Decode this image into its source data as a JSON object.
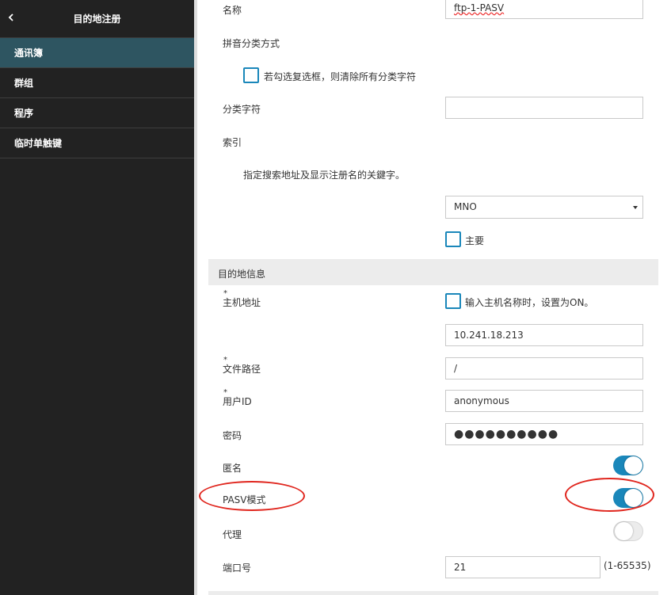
{
  "sidebar": {
    "title": "目的地注册",
    "items": [
      {
        "label": "通讯簿",
        "active": true
      },
      {
        "label": "群组"
      },
      {
        "label": "程序"
      },
      {
        "label": "临时单触键"
      }
    ]
  },
  "form": {
    "name": {
      "label": "名称",
      "value": "ftp-1-PASV"
    },
    "pinyin": {
      "label": "拼音分类方式",
      "checkbox_label": "若勾选复选框，则清除所有分类字符",
      "checked": false
    },
    "category_chars": {
      "label": "分类字符",
      "value": ""
    },
    "index": {
      "label": "索引",
      "description": "指定搜索地址及显示注册名的关鍵字。",
      "selected": "MNO",
      "main_label": "主要",
      "main_checked": false
    },
    "section_title": "目的地信息",
    "host": {
      "required_mark": "*",
      "label": "主机地址",
      "checkbox_label": "输入主机名称时，设置为ON。",
      "checked": false,
      "value": "10.241.18.213"
    },
    "file_path": {
      "required_mark": "*",
      "label": "文件路径",
      "value": "/"
    },
    "user_id": {
      "required_mark": "*",
      "label": "用户ID",
      "value": "anonymous"
    },
    "password": {
      "label": "密码",
      "masked": "●●●●●●●●●●"
    },
    "anonymous": {
      "label": "匿名",
      "on": true
    },
    "pasv": {
      "label": "PASV模式",
      "on": true
    },
    "proxy": {
      "label": "代理",
      "on": false
    },
    "port": {
      "label": "端口号",
      "value": "21",
      "range": "(1-65535)"
    }
  },
  "colors": {
    "accent": "#1a87ba",
    "sidebar_bg": "#222222",
    "sidebar_active": "#2e5561",
    "highlight": "#e0261e"
  }
}
